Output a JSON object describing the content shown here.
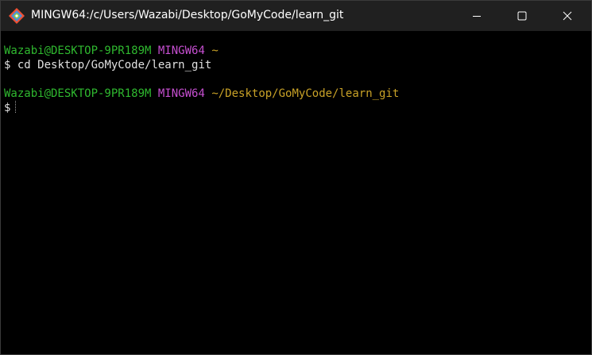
{
  "window": {
    "title": "MINGW64:/c/Users/Wazabi/Desktop/GoMyCode/learn_git",
    "app_icon": "git-diamond-icon",
    "controls": {
      "minimize_icon": "minimize-icon",
      "maximize_icon": "maximize-icon",
      "close_icon": "close-icon"
    }
  },
  "terminal": {
    "prompt1": {
      "user_host": "Wazabi@DESKTOP-9PR189M",
      "env": "MINGW64",
      "path": "~"
    },
    "command1": {
      "symbol": "$",
      "text": "cd Desktop/GoMyCode/learn_git"
    },
    "prompt2": {
      "user_host": "Wazabi@DESKTOP-9PR189M",
      "env": "MINGW64",
      "path": "~/Desktop/GoMyCode/learn_git"
    },
    "command2": {
      "symbol": "$",
      "text": ""
    }
  },
  "colors": {
    "background": "#000000",
    "titlebar": "#202020",
    "user_host": "#2fb82f",
    "env": "#c64fd1",
    "path": "#c9a227",
    "text": "#e0e0e0"
  }
}
